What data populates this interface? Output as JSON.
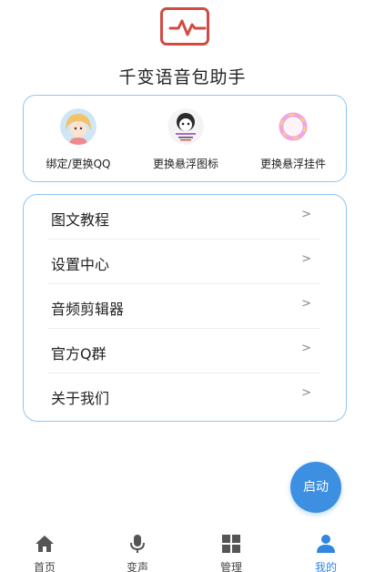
{
  "app": {
    "title": "千变语音包助手",
    "logo_icon": "waveform-icon",
    "brand_color": "#d24a43"
  },
  "shortcuts": [
    {
      "label": "绑定/更换QQ",
      "icon": "avatar-icon"
    },
    {
      "label": "更换悬浮图标",
      "icon": "float-icon-sticker"
    },
    {
      "label": "更换悬浮挂件",
      "icon": "pendant-ring-icon"
    }
  ],
  "menu": [
    {
      "label": "图文教程",
      "chevron": ">"
    },
    {
      "label": "设置中心",
      "chevron": ">"
    },
    {
      "label": "音频剪辑器",
      "chevron": ">"
    },
    {
      "label": "官方Q群",
      "chevron": ">"
    },
    {
      "label": "关于我们",
      "chevron": ">"
    }
  ],
  "start_button": {
    "label": "启动",
    "color": "#3d8fe2"
  },
  "tabbar": {
    "items": [
      {
        "label": "首页",
        "icon": "home-icon"
      },
      {
        "label": "变声",
        "icon": "microphone-icon"
      },
      {
        "label": "管理",
        "icon": "grid-icon"
      },
      {
        "label": "我的",
        "icon": "user-icon"
      }
    ],
    "active": "我的",
    "active_color": "#2f87e0"
  }
}
